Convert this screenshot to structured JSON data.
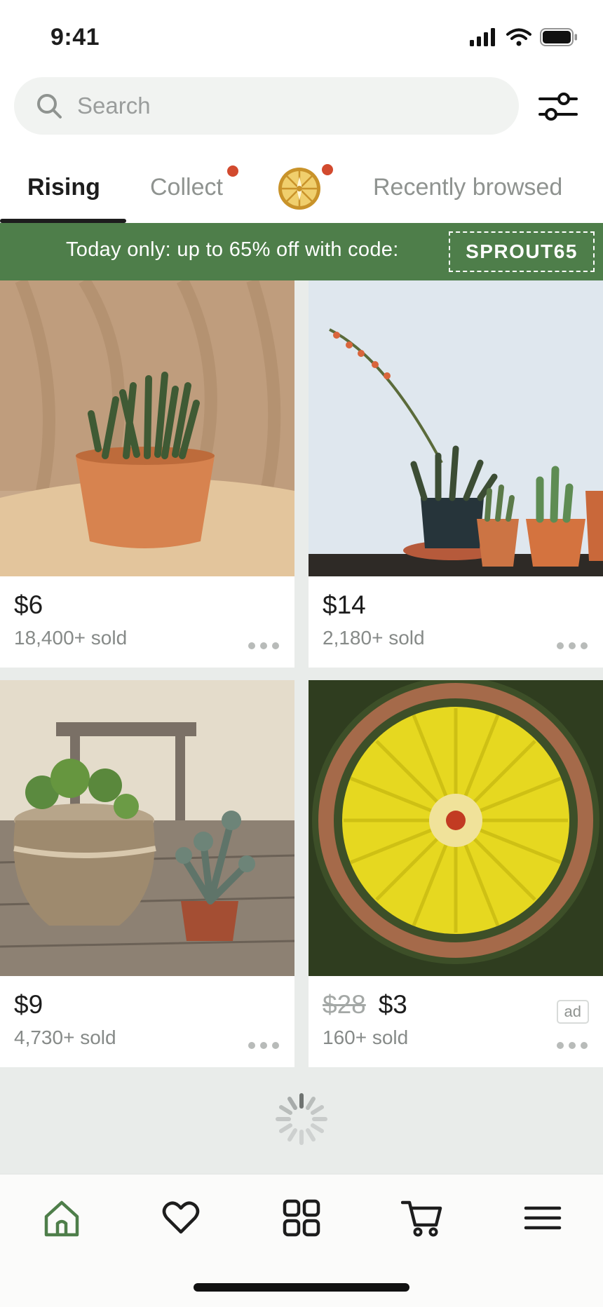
{
  "status": {
    "time": "9:41"
  },
  "search": {
    "placeholder": "Search"
  },
  "tabs": [
    {
      "label": "Rising",
      "active": true
    },
    {
      "label": "Collect",
      "active": false,
      "badge": "red-dot"
    },
    {
      "label": "",
      "icon": "spin-wheel-icon",
      "badge": "red-dot"
    },
    {
      "label": "Recently browsed",
      "active": false
    }
  ],
  "promo": {
    "text": "Today only: up to 65% off with code:",
    "code": "SPROUT65"
  },
  "products": [
    {
      "price": "$6",
      "sold": "18,400+ sold",
      "image": "succulent-in-terracotta-pot"
    },
    {
      "price": "$14",
      "sold": "2,180+ sold",
      "image": "potted-cacti-row"
    },
    {
      "price": "$9",
      "sold": "4,730+ sold",
      "image": "ceramic-and-clay-pots"
    },
    {
      "old_price": "$28",
      "price": "$3",
      "sold": "160+ sold",
      "ad": "ad",
      "image": "yellow-cactus-flower"
    }
  ],
  "bottom_nav": [
    {
      "icon": "home-icon",
      "active": true
    },
    {
      "icon": "heart-icon",
      "active": false
    },
    {
      "icon": "grid-icon",
      "active": false
    },
    {
      "icon": "cart-icon",
      "active": false
    },
    {
      "icon": "menu-icon",
      "active": false
    }
  ],
  "colors": {
    "brand_green": "#4e7e4a",
    "badge_red": "#d24a2e",
    "background": "#e9ecea"
  }
}
